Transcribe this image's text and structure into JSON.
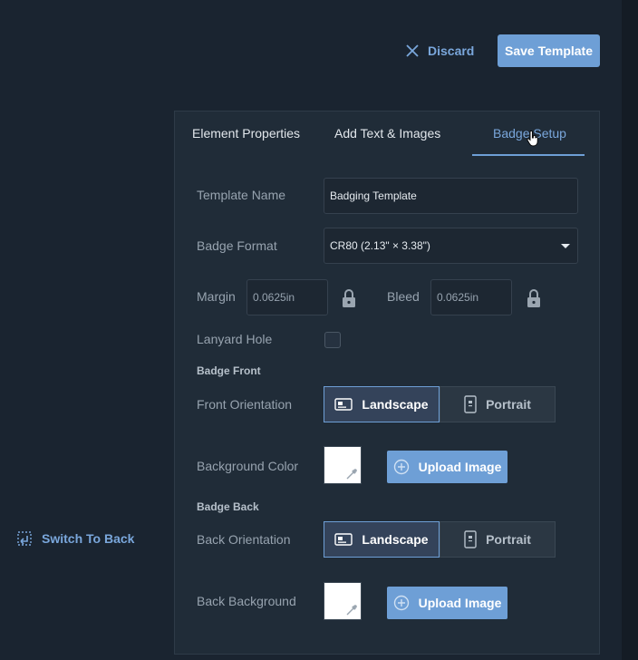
{
  "header": {
    "discard_label": "Discard",
    "save_label": "Save Template"
  },
  "sidebar": {
    "switch_back_label": "Switch To Back"
  },
  "tabs": [
    {
      "label": "Element Properties",
      "active": false
    },
    {
      "label": "Add Text & Images",
      "active": false
    },
    {
      "label": "Badge Setup",
      "active": true
    }
  ],
  "form": {
    "template_name_label": "Template Name",
    "template_name_value": "Badging Template",
    "badge_format_label": "Badge Format",
    "badge_format_value": "CR80 (2.13\" × 3.38\")",
    "margin_label": "Margin",
    "margin_value": "0.0625in",
    "bleed_label": "Bleed",
    "bleed_value": "0.0625in",
    "lanyard_label": "Lanyard Hole",
    "lanyard_checked": false
  },
  "front": {
    "section_title": "Badge Front",
    "orientation_label": "Front Orientation",
    "landscape_label": "Landscape",
    "portrait_label": "Portrait",
    "selected": "Landscape",
    "bg_label": "Background Color",
    "bg_color": "#ffffff",
    "upload_label": "Upload Image"
  },
  "back": {
    "section_title": "Badge Back",
    "orientation_label": "Back Orientation",
    "landscape_label": "Landscape",
    "portrait_label": "Portrait",
    "selected": "Landscape",
    "bg_label": "Back Background",
    "bg_color": "#ffffff",
    "upload_label": "Upload Image"
  },
  "colors": {
    "accent": "#6e9fd6",
    "link": "#7aa7dc",
    "page_bg": "#1a2430",
    "panel_bg": "#202c38"
  },
  "icons": [
    "close-icon",
    "switch-side-icon",
    "lock-icon",
    "landscape-card-icon",
    "portrait-card-icon",
    "eyedropper-icon",
    "plus-circle-icon",
    "pointer-cursor-icon"
  ]
}
